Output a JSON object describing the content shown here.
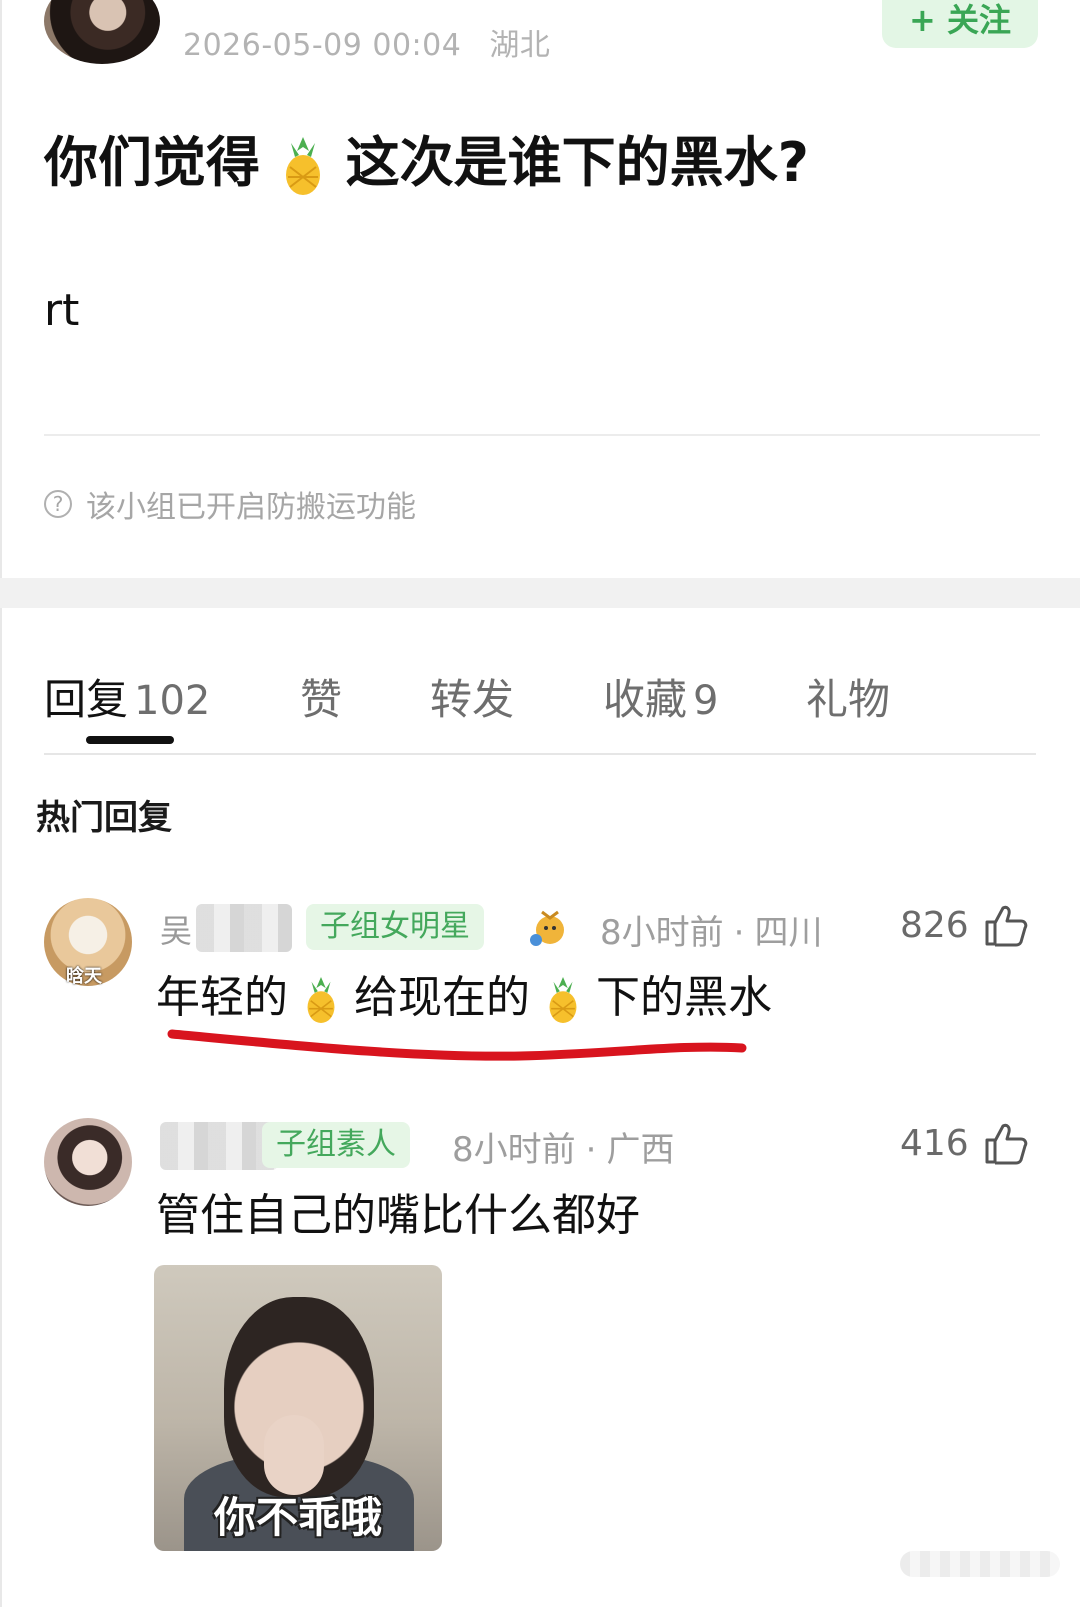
{
  "post": {
    "timestamp": "2026-05-09 00:04",
    "location": "湖北",
    "follow_label": "+ 关注",
    "title_before_emoji": "你们觉得",
    "title_emoji": "pineapple-emoji",
    "title_after_emoji": "这次是谁下的黑水?",
    "body": "rt",
    "anti_repost_notice": "该小组已开启防搬运功能"
  },
  "tabs": [
    {
      "label": "回复",
      "count": "102",
      "active": true
    },
    {
      "label": "赞",
      "count": "",
      "active": false
    },
    {
      "label": "转发",
      "count": "",
      "active": false
    },
    {
      "label": "收藏",
      "count": "9",
      "active": false
    },
    {
      "label": "礼物",
      "count": "",
      "active": false
    }
  ],
  "hot_replies_title": "热门回复",
  "replies": [
    {
      "name_visible_char": "吴",
      "badge": "子组女明星",
      "time": "8小时前",
      "location": "四川",
      "likes": "826",
      "text_part1": "年轻的",
      "text_part2": "给现在的",
      "text_part3": "下的黑水",
      "emoji": "pineapple-emoji",
      "avatar_caption": "晗天"
    },
    {
      "badge": "子组素人",
      "time": "8小时前",
      "location": "广西",
      "likes": "416",
      "text": "管住自己的嘴比什么都好",
      "meme_caption": "你不乖哦"
    }
  ],
  "colors": {
    "accent_green": "#3aa655",
    "badge_bg": "#e6f6e6",
    "underline_red": "#d8141e"
  }
}
